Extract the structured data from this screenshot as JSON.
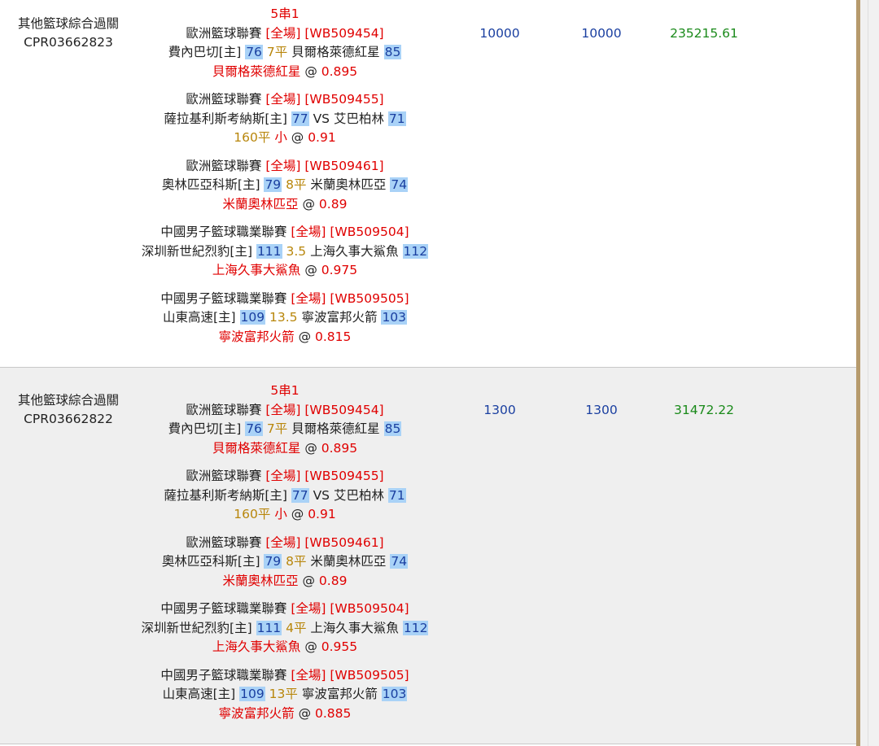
{
  "bets": [
    {
      "type_label": "其他籃球綜合過關",
      "bet_id": "CPR03662823",
      "combo": "5串1",
      "stake": "10000",
      "valid_amount": "10000",
      "payout": "235215.61",
      "legs": [
        {
          "league": "歐洲籃球聯賽",
          "period": "[全場]",
          "match_code": "[WB509454]",
          "home": "費內巴切[主]",
          "home_score": "76",
          "handicap": "7平",
          "vs": "",
          "away": "貝爾格萊德紅星",
          "away_score": "85",
          "pick": "貝爾格萊德紅星",
          "pick_plain": "",
          "odds_prefix": " @ ",
          "odds": "0.895"
        },
        {
          "league": "歐洲籃球聯賽",
          "period": "[全場]",
          "match_code": "[WB509455]",
          "home": "薩拉基利斯考納斯[主]",
          "home_score": "77",
          "handicap": "",
          "vs": "VS",
          "away": "艾巴柏林",
          "away_score": "71",
          "pick": "160平",
          "pick_plain": "小",
          "odds_prefix": " @ ",
          "odds": "0.91"
        },
        {
          "league": "歐洲籃球聯賽",
          "period": "[全場]",
          "match_code": "[WB509461]",
          "home": "奧林匹亞科斯[主]",
          "home_score": "79",
          "handicap": "8平",
          "vs": "",
          "away": "米蘭奧林匹亞",
          "away_score": "74",
          "pick": "米蘭奧林匹亞",
          "pick_plain": "",
          "odds_prefix": " @ ",
          "odds": "0.89"
        },
        {
          "league": "中國男子籃球職業聯賽",
          "period": "[全場]",
          "match_code": "[WB509504]",
          "home": "深圳新世紀烈豹[主]",
          "home_score": "111",
          "handicap": "3.5",
          "vs": "",
          "away": "上海久事大鯊魚",
          "away_score": "112",
          "pick": "上海久事大鯊魚",
          "pick_plain": "",
          "odds_prefix": " @ ",
          "odds": "0.975"
        },
        {
          "league": "中國男子籃球職業聯賽",
          "period": "[全場]",
          "match_code": "[WB509505]",
          "home": "山東高速[主]",
          "home_score": "109",
          "handicap": "13.5",
          "vs": "",
          "away": "寧波富邦火箭",
          "away_score": "103",
          "pick": "寧波富邦火箭",
          "pick_plain": "",
          "odds_prefix": " @ ",
          "odds": "0.815"
        }
      ]
    },
    {
      "type_label": "其他籃球綜合過關",
      "bet_id": "CPR03662822",
      "combo": "5串1",
      "stake": "1300",
      "valid_amount": "1300",
      "payout": "31472.22",
      "legs": [
        {
          "league": "歐洲籃球聯賽",
          "period": "[全場]",
          "match_code": "[WB509454]",
          "home": "費內巴切[主]",
          "home_score": "76",
          "handicap": "7平",
          "vs": "",
          "away": "貝爾格萊德紅星",
          "away_score": "85",
          "pick": "貝爾格萊德紅星",
          "pick_plain": "",
          "odds_prefix": " @ ",
          "odds": "0.895"
        },
        {
          "league": "歐洲籃球聯賽",
          "period": "[全場]",
          "match_code": "[WB509455]",
          "home": "薩拉基利斯考納斯[主]",
          "home_score": "77",
          "handicap": "",
          "vs": "VS",
          "away": "艾巴柏林",
          "away_score": "71",
          "pick": "160平",
          "pick_plain": "小",
          "odds_prefix": " @ ",
          "odds": "0.91"
        },
        {
          "league": "歐洲籃球聯賽",
          "period": "[全場]",
          "match_code": "[WB509461]",
          "home": "奧林匹亞科斯[主]",
          "home_score": "79",
          "handicap": "8平",
          "vs": "",
          "away": "米蘭奧林匹亞",
          "away_score": "74",
          "pick": "米蘭奧林匹亞",
          "pick_plain": "",
          "odds_prefix": " @ ",
          "odds": "0.89"
        },
        {
          "league": "中國男子籃球職業聯賽",
          "period": "[全場]",
          "match_code": "[WB509504]",
          "home": "深圳新世紀烈豹[主]",
          "home_score": "111",
          "handicap": "4平",
          "vs": "",
          "away": "上海久事大鯊魚",
          "away_score": "112",
          "pick": "上海久事大鯊魚",
          "pick_plain": "",
          "odds_prefix": " @ ",
          "odds": "0.955"
        },
        {
          "league": "中國男子籃球職業聯賽",
          "period": "[全場]",
          "match_code": "[WB509505]",
          "home": "山東高速[主]",
          "home_score": "109",
          "handicap": "13平",
          "vs": "",
          "away": "寧波富邦火箭",
          "away_score": "103",
          "pick": "寧波富邦火箭",
          "pick_plain": "",
          "odds_prefix": " @ ",
          "odds": "0.885"
        }
      ]
    }
  ]
}
